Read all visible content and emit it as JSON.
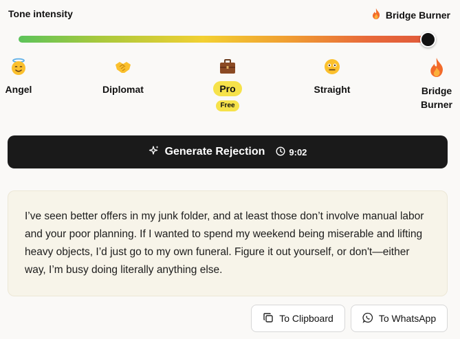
{
  "tone_slider": {
    "label": "Tone intensity",
    "current": "Bridge Burner",
    "value": 1.0
  },
  "tones": [
    {
      "name": "Angel",
      "icon": "angel-face-icon"
    },
    {
      "name": "Diplomat",
      "icon": "handshake-icon"
    },
    {
      "name": "Pro",
      "icon": "briefcase-icon",
      "badge": "Free"
    },
    {
      "name": "Straight",
      "icon": "neutral-face-icon"
    },
    {
      "name": "Bridge Burner",
      "icon": "fire-icon"
    }
  ],
  "generate": {
    "label": "Generate Rejection",
    "timer": "9:02",
    "icon": "sparkles-icon"
  },
  "output": {
    "text": "I’ve seen better offers in my junk folder, and at least those don’t involve manual labor and your poor planning. If I wanted to spend my weekend being miserable and lifting heavy objects, I’d just go to my own funeral. Figure it out yourself, or don't—either way, I’m busy doing literally anything else."
  },
  "actions": {
    "clipboard": "To Clipboard",
    "whatsapp": "To WhatsApp"
  },
  "colors": {
    "accent_yellow": "#f6e24a",
    "button_dark": "#1a1a1a",
    "output_bg": "#f7f4e9"
  }
}
